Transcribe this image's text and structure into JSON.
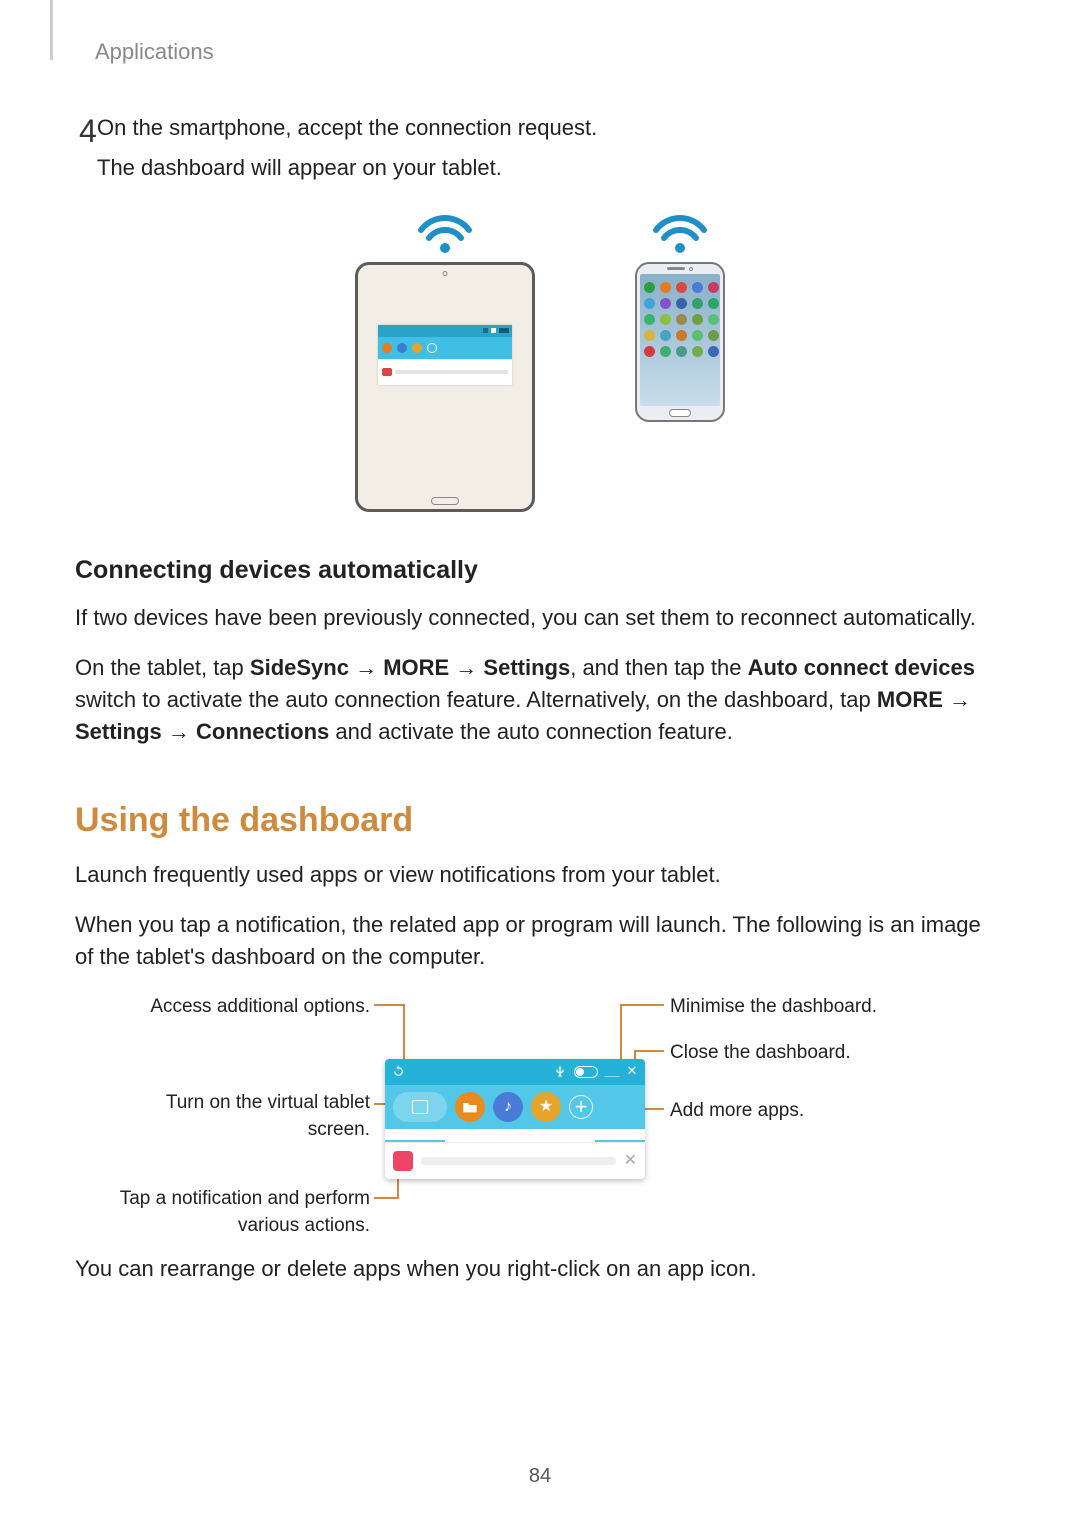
{
  "header": {
    "section": "Applications"
  },
  "step4": {
    "num": "4",
    "line1": "On the smartphone, accept the connection request.",
    "line2": "The dashboard will appear on your tablet."
  },
  "connecting": {
    "heading": "Connecting devices automatically",
    "p1": "If two devices have been previously connected, you can set them to reconnect automatically.",
    "p2a": "On the tablet, tap ",
    "p2b": "SideSync",
    "arrow": " → ",
    "p2c": "MORE",
    "p2d": "Settings",
    "p2e": ", and then tap the ",
    "p2f": "Auto connect devices",
    "p2g": " switch to activate the auto connection feature. Alternatively, on the dashboard, tap ",
    "p2h": "MORE",
    "p2i": "Settings",
    "p2j": "Connections",
    "p2k": " and activate the auto connection feature."
  },
  "using": {
    "heading": "Using the dashboard",
    "p1": "Launch frequently used apps or view notifications from your tablet.",
    "p2": "When you tap a notification, the related app or program will launch. The following is an image of the tablet's dashboard on the computer.",
    "p3": "You can rearrange or delete apps when you right-click on an app icon."
  },
  "callouts": {
    "options": "Access additional options.",
    "vscreen1": "Turn on the virtual tablet",
    "vscreen2": "screen.",
    "notif1": "Tap a notification and perform",
    "notif2": "various actions.",
    "minimise": "Minimise the dashboard.",
    "close": "Close the dashboard.",
    "addapps": "Add more apps."
  },
  "pageNumber": "84",
  "phone_icon_colors": [
    "#2c9e3e",
    "#e57a1f",
    "#d94b3d",
    "#4a7bd6",
    "#c93b63",
    "#3fa4d6",
    "#8453c7",
    "#3a64a8",
    "#35a06e",
    "#2aa66a",
    "#37b56e",
    "#8bbf3c",
    "#9b8b4a",
    "#6fa23f",
    "#5abf78",
    "#d9b23f",
    "#4aa3c4",
    "#c97a2a",
    "#5bbf6e",
    "#6f9a4a",
    "#d13e3e",
    "#3fae6e",
    "#4a9b8a",
    "#6fb04c",
    "#3b67b8"
  ]
}
